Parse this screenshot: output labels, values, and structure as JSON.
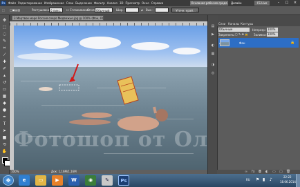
{
  "menubar": {
    "logo": "Ps",
    "items": [
      "Файл",
      "Редактирование",
      "Изображение",
      "Слои",
      "Выделение",
      "Фильтр",
      "Анализ",
      "3D",
      "Просмотр",
      "Окно",
      "Справка"
    ],
    "workspace_active": "Основная рабочая среда",
    "workspace_design": "Дизайн",
    "cs_live": "CS Live"
  },
  "options": {
    "feather_label": "Растушевка:",
    "feather_value": "0 пикс.",
    "antialias_label": "Сглаживание",
    "style_label": "Стиль:",
    "style_value": "Обычный",
    "width_label": "Шир.:",
    "height_label": "Выс.:",
    "refine_button": "Уточн. край..."
  },
  "document": {
    "tab_title": "3 Мертвое море Россия озеро Медвежье.jpg @ 100% (Фон, RGB/8) *",
    "zoom": "100%",
    "doc_size": "Док: 1,16M/1,16M",
    "watermark": "Фотошоп от Олечки"
  },
  "layers_panel": {
    "tabs": [
      "Слои",
      "Каналы",
      "Контуры"
    ],
    "blend_mode": "Обычные",
    "opacity_label": "Непрозр.:",
    "opacity_value": "100%",
    "lock_label": "Закрепить:",
    "fill_label": "Заливка:",
    "fill_value": "100%",
    "layer_name": "Фон",
    "bottom_icons": [
      "link-icon",
      "fx-icon",
      "mask-icon",
      "adjustment-icon",
      "folder-icon",
      "new-layer-icon",
      "trash-icon"
    ]
  },
  "taskbar": {
    "apps": [
      "ie-icon",
      "folder-icon",
      "media-player-icon",
      "word-icon",
      "chrome-icon",
      "paint-icon",
      "photoshop-icon"
    ],
    "language": "RU",
    "time": "22:22",
    "date": "18.06.2014"
  },
  "colors": {
    "selection_layer": "#2d6ec5",
    "taskbar": "#2a4763",
    "panel_bg": "#5c5c5c"
  }
}
